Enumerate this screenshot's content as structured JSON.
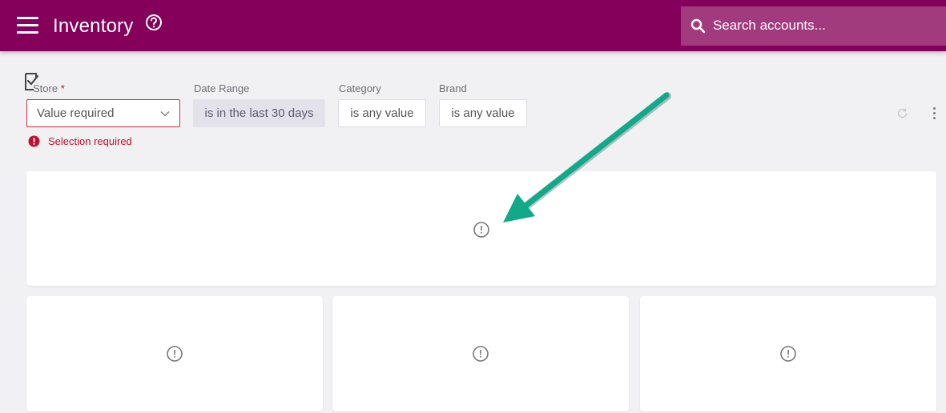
{
  "header": {
    "title": "Inventory",
    "search_placeholder": "Search accounts...",
    "bar_color": "#85005a",
    "search_color": "#a23a7e"
  },
  "filters": {
    "store": {
      "label": "Store",
      "required_mark": "*",
      "value": "Value required",
      "error": "Selection required"
    },
    "date_range": {
      "label": "Date Range",
      "value": "is in the last 30 days"
    },
    "category": {
      "label": "Category",
      "value": "is any value"
    },
    "brand": {
      "label": "Brand",
      "value": "is any value"
    }
  },
  "tiles": [
    {
      "name": "top-wide",
      "icon": "exclamation-circle-icon"
    },
    {
      "name": "bottom-left",
      "icon": "exclamation-circle-icon"
    },
    {
      "name": "bottom-middle",
      "icon": "exclamation-circle-icon"
    },
    {
      "name": "bottom-right",
      "icon": "exclamation-circle-icon"
    }
  ],
  "annotation": {
    "type": "arrow",
    "color": "#10a98a"
  },
  "colors": {
    "error": "#c0102c",
    "date_chip_bg": "#e3e1ea"
  }
}
